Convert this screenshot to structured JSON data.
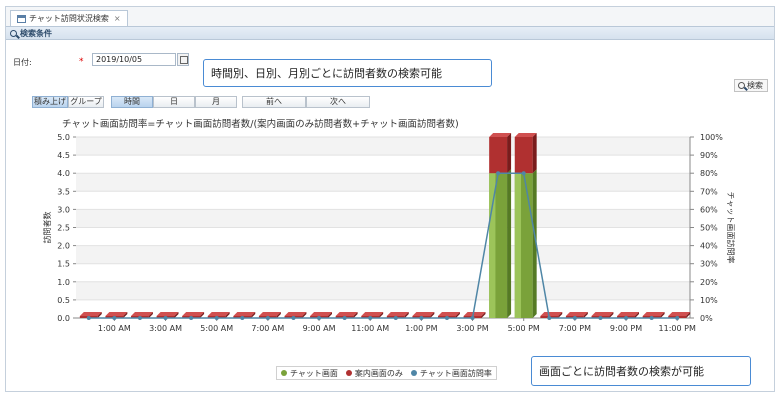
{
  "tab": {
    "title": "チャット訪問状況検索",
    "close": "×"
  },
  "section": {
    "title": "検索条件"
  },
  "form": {
    "date_label": "日付:",
    "required_mark": "*",
    "date_value": "2019/10/05"
  },
  "search_button": {
    "label": "検索"
  },
  "segments": {
    "stacked": "積み上げ",
    "group": "グループ",
    "hourly": "時間",
    "daily": "日",
    "monthly": "月",
    "prev": "前へ",
    "next": "次へ"
  },
  "callouts": {
    "top": "時間別、日別、月別ごとに訪問者数の検索可能",
    "bottom": "画面ごとに訪問者数の検索が可能"
  },
  "colors": {
    "chat_screen": "#7aa23a",
    "guide_only": "#b03030",
    "visit_rate": "#4f86a6",
    "accent": "#4a8bd4"
  },
  "chart_data": {
    "type": "bar",
    "title": "チャット画面訪問率=チャット画面訪問者数/(案内画面のみ訪問者数+チャット画面訪問者数)",
    "ylabel": "訪問者数",
    "y2label": "チャット画面訪問率",
    "ylim": [
      0,
      5
    ],
    "y2lim": [
      0,
      100
    ],
    "yticks": [
      "0.0",
      "0.5",
      "1.0",
      "1.5",
      "2.0",
      "2.5",
      "3.0",
      "3.5",
      "4.0",
      "4.5",
      "5.0"
    ],
    "y2ticks": [
      "0%",
      "10%",
      "20%",
      "30%",
      "40%",
      "50%",
      "60%",
      "70%",
      "80%",
      "90%",
      "100%"
    ],
    "x": [
      0,
      1,
      2,
      3,
      4,
      5,
      6,
      7,
      8,
      9,
      10,
      11,
      12,
      13,
      14,
      15,
      16,
      17,
      18,
      19,
      20,
      21,
      22,
      23
    ],
    "xtick_labels": [
      {
        "x": 1,
        "label": "1:00 AM"
      },
      {
        "x": 3,
        "label": "3:00 AM"
      },
      {
        "x": 5,
        "label": "5:00 AM"
      },
      {
        "x": 7,
        "label": "7:00 AM"
      },
      {
        "x": 9,
        "label": "9:00 AM"
      },
      {
        "x": 11,
        "label": "11:00 AM"
      },
      {
        "x": 13,
        "label": "1:00 PM"
      },
      {
        "x": 15,
        "label": "3:00 PM"
      },
      {
        "x": 17,
        "label": "5:00 PM"
      },
      {
        "x": 19,
        "label": "7:00 PM"
      },
      {
        "x": 21,
        "label": "9:00 PM"
      },
      {
        "x": 23,
        "label": "11:00 PM"
      }
    ],
    "series": [
      {
        "name": "チャット画面",
        "axis": "left",
        "values": [
          0,
          0,
          0,
          0,
          0,
          0,
          0,
          0,
          0,
          0,
          0,
          0,
          0,
          0,
          0,
          0,
          4,
          4,
          0,
          0,
          0,
          0,
          0,
          0
        ]
      },
      {
        "name": "案内画面のみ",
        "axis": "left",
        "values": [
          0,
          0,
          0,
          0,
          0,
          0,
          0,
          0,
          0,
          0,
          0,
          0,
          0,
          0,
          0,
          0,
          1,
          1,
          0,
          0,
          0,
          0,
          0,
          0
        ]
      },
      {
        "name": "チャット画面訪問率",
        "axis": "right",
        "type": "line",
        "values": [
          0,
          0,
          0,
          0,
          0,
          0,
          0,
          0,
          0,
          0,
          0,
          0,
          0,
          0,
          0,
          0,
          80,
          80,
          0,
          0,
          0,
          0,
          0,
          0
        ]
      }
    ],
    "grid": true,
    "legend_position": "bottom"
  }
}
